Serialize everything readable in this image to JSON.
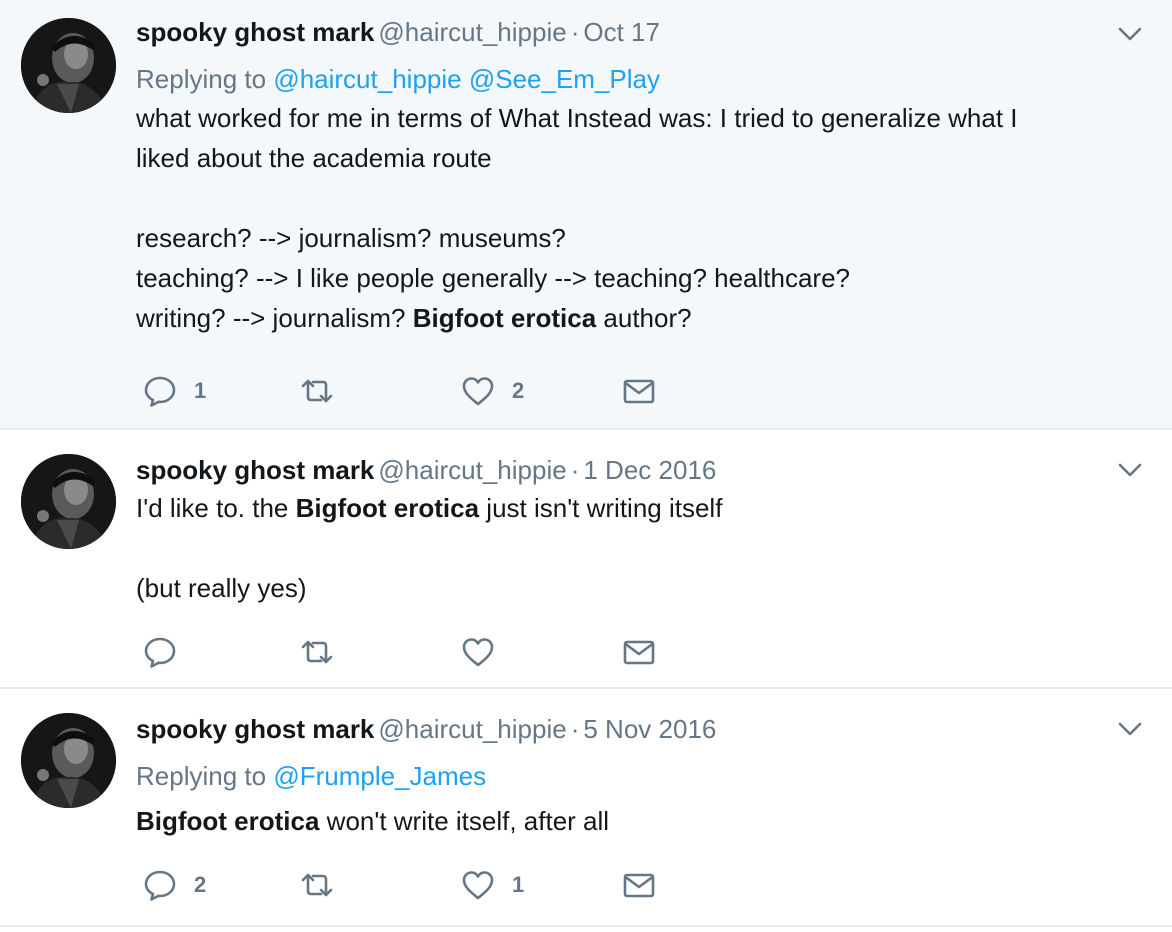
{
  "tweets": [
    {
      "author_name": "spooky ghost mark",
      "handle": "@haircut_hippie",
      "separator": "·",
      "date": "Oct 17",
      "replying_label": "Replying to",
      "replying_to": [
        "@haircut_hippie",
        "@See_Em_Play"
      ],
      "body": [
        [
          "what worked for me in terms of What Instead was: I tried to generalize what I"
        ],
        [
          "liked about the academia route"
        ],
        [
          ""
        ],
        [
          "research? --> journalism? museums?"
        ],
        [
          "teaching? --> I like people generally --> teaching? healthcare?"
        ],
        [
          "writing? --> journalism? ",
          {
            "bold": "Bigfoot erotica"
          },
          " author?"
        ]
      ],
      "reply_count": "1",
      "retweet_count": "",
      "like_count": "2"
    },
    {
      "author_name": "spooky ghost mark",
      "handle": "@haircut_hippie",
      "separator": "·",
      "date": "1 Dec 2016",
      "body": [
        [
          "I'd like to. the ",
          {
            "bold": "Bigfoot erotica"
          },
          " just isn't writing itself"
        ],
        [
          ""
        ],
        [
          "(but really yes)"
        ]
      ],
      "reply_count": "",
      "retweet_count": "",
      "like_count": ""
    },
    {
      "author_name": "spooky ghost mark",
      "handle": "@haircut_hippie",
      "separator": "·",
      "date": "5 Nov 2016",
      "replying_label": "Replying to",
      "replying_to": [
        "@Frumple_James"
      ],
      "body": [
        [
          {
            "bold": "Bigfoot erotica"
          },
          " won't write itself, after all"
        ]
      ],
      "reply_count": "2",
      "retweet_count": "",
      "like_count": "1"
    }
  ],
  "icons": {
    "reply": "reply-icon",
    "retweet": "retweet-icon",
    "like": "heart-icon",
    "dm": "envelope-icon",
    "menu": "chevron-down-icon"
  },
  "colors": {
    "link": "#1da1f2",
    "secondary_text": "#657786",
    "highlight_background": "#f5f8fa",
    "divider": "#e6ecf0"
  }
}
